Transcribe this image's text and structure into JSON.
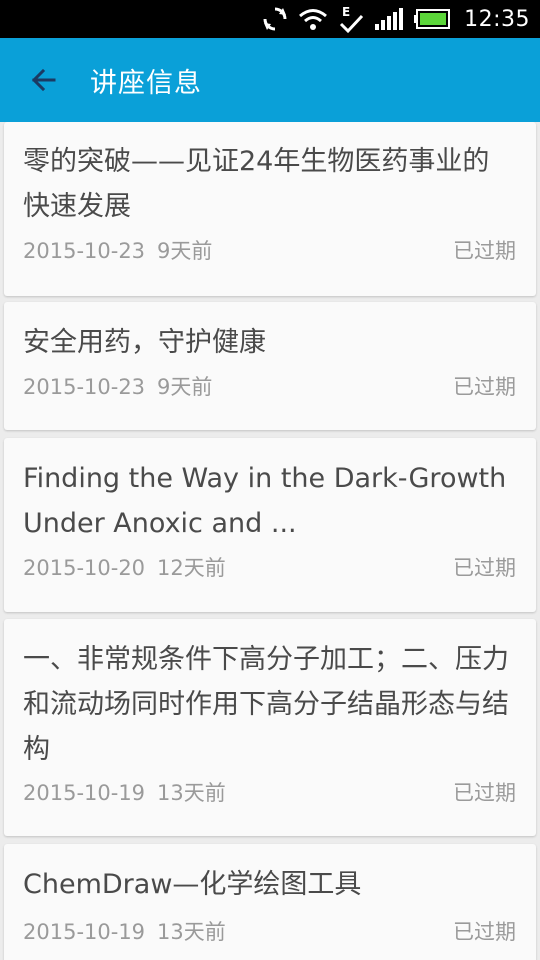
{
  "status": {
    "time": "12:35"
  },
  "header": {
    "title": "讲座信息"
  },
  "lectures": [
    {
      "title": "零的突破——见证24年生物医药事业的快速发展",
      "date": "2015-10-23",
      "ago": "9天前",
      "status": "已过期"
    },
    {
      "title": "安全用药，守护健康",
      "date": "2015-10-23",
      "ago": "9天前",
      "status": "已过期"
    },
    {
      "title": "Finding the Way in the Dark-Growth Under Anoxic and ...",
      "date": "2015-10-20",
      "ago": "12天前",
      "status": "已过期"
    },
    {
      "title": "一、非常规条件下高分子加工；二、压力和流动场同时作用下高分子结晶形态与结构",
      "date": "2015-10-19",
      "ago": "13天前",
      "status": "已过期"
    },
    {
      "title": "ChemDraw—化学绘图工具",
      "date": "2015-10-19",
      "ago": "13天前",
      "status": "已过期"
    }
  ]
}
